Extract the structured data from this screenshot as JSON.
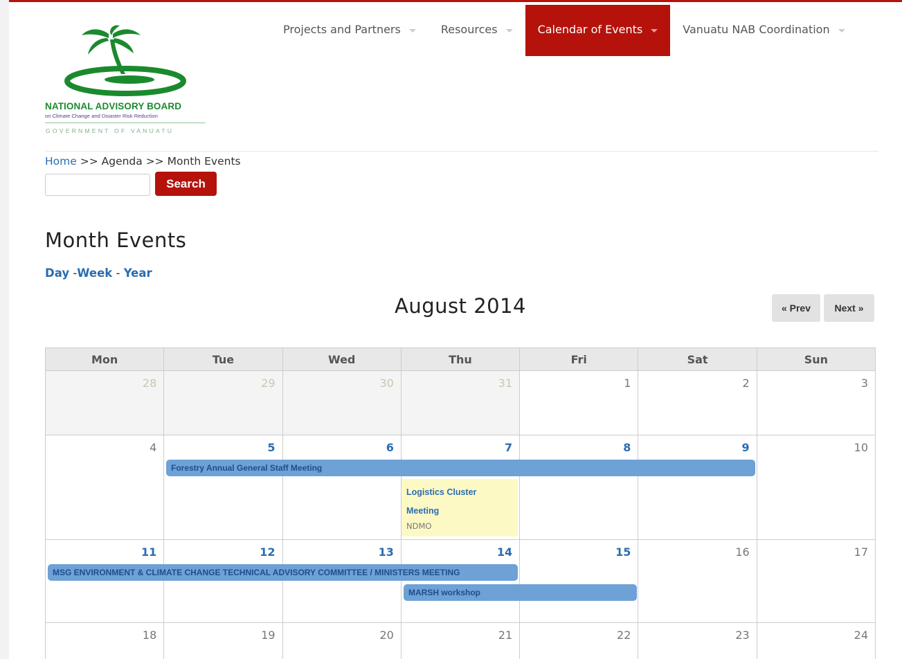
{
  "logo": {
    "title": "NATIONAL ADVISORY BOARD",
    "subtitle": "on Climate Change and Disaster Risk Reduction",
    "government": "GOVERNMENT OF VANUATU",
    "colors": {
      "green": "#1b8a2e",
      "purple": "#5a3b8f"
    }
  },
  "nav": {
    "items": [
      {
        "label": "Projects and Partners"
      },
      {
        "label": "Resources"
      },
      {
        "label": "Calendar of Events",
        "active": true
      },
      {
        "label": "Vanuatu NAB Coordination"
      }
    ],
    "accent": "#b5120c"
  },
  "breadcrumb": {
    "home": "Home",
    "sep1": " >> ",
    "agenda": "Agenda",
    "sep2": " >> ",
    "current": "Month Events"
  },
  "search": {
    "placeholder": "",
    "value": "",
    "button": "Search"
  },
  "page": {
    "title": "Month Events"
  },
  "views": {
    "day": "Day",
    "sep1": " -",
    "week": "Week",
    "sep2": " - ",
    "year": "Year"
  },
  "calendar": {
    "month_title": "August 2014",
    "prev": "« Prev",
    "next": "Next »",
    "weekdays": [
      "Mon",
      "Tue",
      "Wed",
      "Thu",
      "Fri",
      "Sat",
      "Sun"
    ],
    "weeks": [
      [
        "28",
        "29",
        "30",
        "31",
        "1",
        "2",
        "3"
      ],
      [
        "4",
        "5",
        "6",
        "7",
        "8",
        "9",
        "10"
      ],
      [
        "11",
        "12",
        "13",
        "14",
        "15",
        "16",
        "17"
      ],
      [
        "18",
        "19",
        "20",
        "21",
        "22",
        "23",
        "24"
      ]
    ],
    "events": {
      "forestry": "Forestry Annual General Staff Meeting",
      "logistics_title": "Logistics Cluster Meeting",
      "logistics_title_line1": "Logistics Cluster",
      "logistics_title_line2": "Meeting",
      "logistics_org": "NDMO",
      "msg": "MSG ENVIRONMENT & CLIMATE CHANGE TECHNICAL ADVISORY COMMITTEE / MINISTERS MEETING",
      "marsh": "MARSH workshop"
    }
  }
}
